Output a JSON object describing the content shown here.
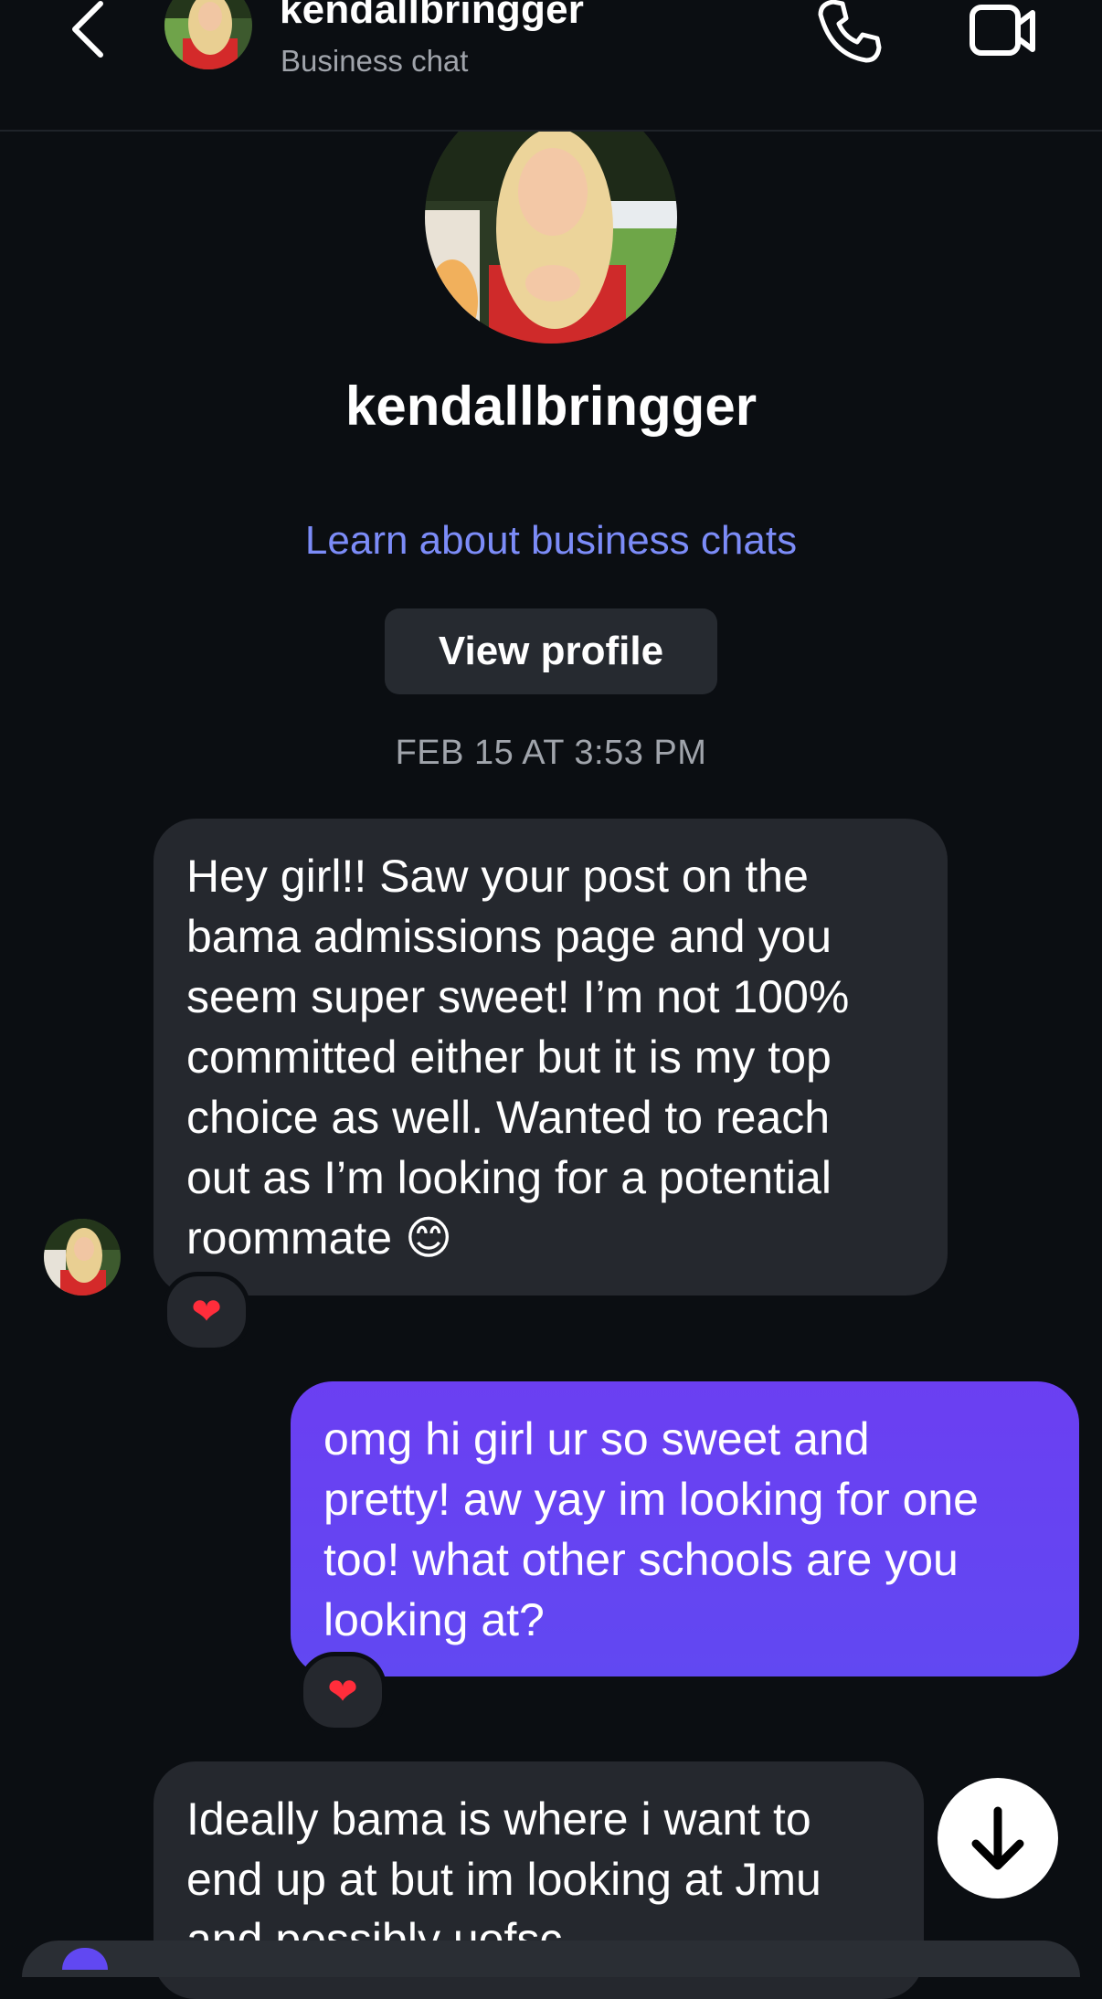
{
  "header": {
    "username": "kendallbringger",
    "subtitle": "Business chat",
    "back_icon": "chevron-left-icon",
    "call_icon": "phone-icon",
    "video_icon": "video-camera-icon"
  },
  "profile": {
    "name": "kendallbringger",
    "learn_link": "Learn about business chats",
    "view_profile_label": "View profile"
  },
  "timestamp": "FEB 15 AT 3:53 PM",
  "messages": [
    {
      "direction": "incoming",
      "lines": [
        "Hey girl!! Saw your post on the",
        "bama admissions page and you",
        "seem super sweet! I’m not 100%",
        "committed either but it is my top",
        "choice as well. Wanted to reach",
        "out as I’m looking for a potential",
        "roommate 😊"
      ],
      "reaction": "❤"
    },
    {
      "direction": "outgoing",
      "lines": [
        "omg hi girl ur so sweet and",
        "pretty! aw yay im looking for one",
        "too! what other schools are you",
        "looking at?"
      ],
      "reaction": "❤"
    },
    {
      "direction": "incoming",
      "lines": [
        "Ideally bama is where i want to",
        "end up at but im looking at Jmu",
        "and possibly uofsc"
      ]
    }
  ],
  "scroll_icon": "arrow-down-icon",
  "colors": {
    "background": "#0b0e12",
    "incoming_bubble": "#25282e",
    "outgoing_bubble": "#6148f2",
    "link": "#7c8cf8",
    "secondary_text": "#a0a4ab"
  }
}
